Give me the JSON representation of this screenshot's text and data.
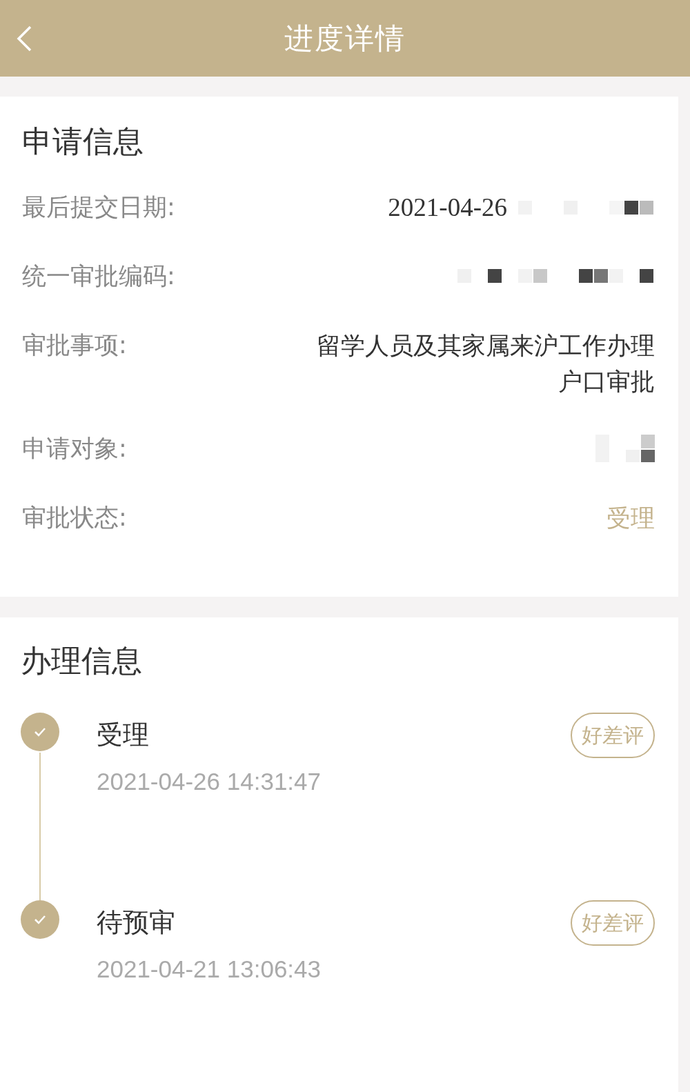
{
  "header": {
    "title": "进度详情"
  },
  "application": {
    "title": "申请信息",
    "fields": [
      {
        "label": "最后提交日期:",
        "kind": "text",
        "value": "2021-04-26",
        "redacted": true
      },
      {
        "label": "统一审批编码:",
        "kind": "text",
        "redacted": true
      },
      {
        "label": "审批事项:",
        "kind": "text",
        "value": "留学人员及其家属来沪工作办理户口审批",
        "redacted": false
      },
      {
        "label": "申请对象:",
        "kind": "text",
        "redacted": true
      },
      {
        "label": "审批状态:",
        "kind": "status",
        "value": "受理",
        "redacted": false
      }
    ]
  },
  "processing": {
    "title": "办理信息",
    "steps": [
      {
        "title": "受理",
        "time": "2021-04-26 14:31:47",
        "done": true,
        "button": "好差评"
      },
      {
        "title": "待预审",
        "time": "2021-04-21 13:06:43",
        "done": true,
        "button": "好差评"
      }
    ]
  }
}
